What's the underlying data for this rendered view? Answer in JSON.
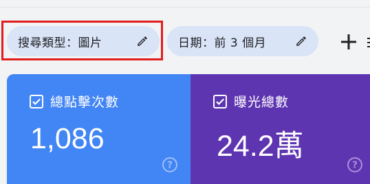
{
  "filters": {
    "search_type_chip": "搜尋類型：圖片",
    "date_chip": "日期：前 3 個月"
  },
  "metrics": {
    "clicks": {
      "label": "總點擊次數",
      "value": "1,086",
      "checked": true,
      "color": "#4285f4"
    },
    "impressions": {
      "label": "曝光總數",
      "value": "24.2萬",
      "checked": true,
      "color": "#5e35b1"
    }
  },
  "colors": {
    "chip_bg": "#d9e4f7",
    "highlight": "#e01c1c"
  }
}
